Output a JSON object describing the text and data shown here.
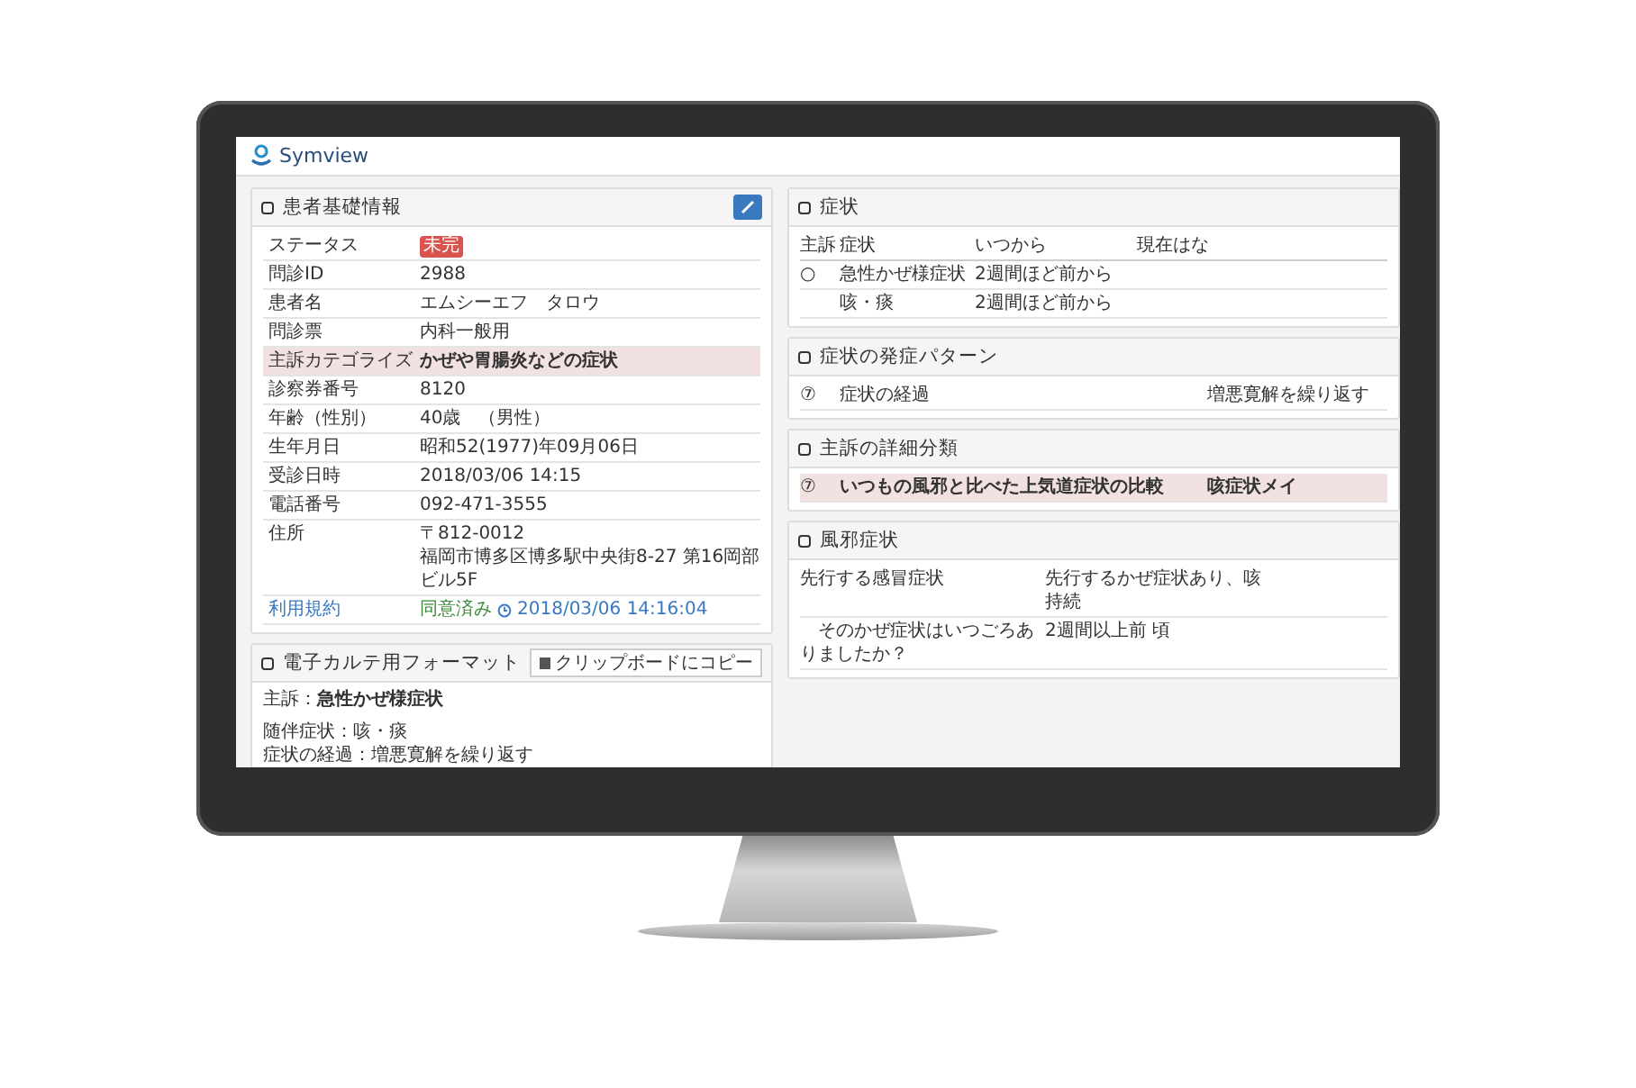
{
  "app": {
    "brand": "Symview"
  },
  "patient": {
    "title": "患者基礎情報",
    "rows": [
      {
        "kind": "badge",
        "label": "ステータス",
        "value": "未完",
        "highlighted": false
      },
      {
        "kind": "text",
        "label": "問診ID",
        "value": "2988",
        "highlighted": false
      },
      {
        "kind": "text",
        "label": "患者名",
        "value": "エムシーエフ　タロウ",
        "highlighted": false
      },
      {
        "kind": "text",
        "label": "問診票",
        "value": "内科一般用",
        "highlighted": false
      },
      {
        "kind": "text",
        "label": "主訴カテゴライズ",
        "value": "かぜや胃腸炎などの症状",
        "highlighted": true
      },
      {
        "kind": "text",
        "label": "診察券番号",
        "value": "8120",
        "highlighted": false
      },
      {
        "kind": "text",
        "label": "年齢（性別）",
        "value": "40歳　（男性）",
        "highlighted": false
      },
      {
        "kind": "text",
        "label": "生年月日",
        "value": "昭和52(1977)年09月06日",
        "highlighted": false
      },
      {
        "kind": "text",
        "label": "受診日時",
        "value": "2018/03/06 14:15",
        "highlighted": false
      },
      {
        "kind": "text",
        "label": "電話番号",
        "value": "092-471-3555",
        "highlighted": false
      },
      {
        "kind": "address",
        "label": "住所",
        "value": "〒812-0012",
        "value2": "福岡市博多区博多駅中央街8-27 第16岡部ビル5F",
        "highlighted": false
      },
      {
        "kind": "consent",
        "label": "利用規約",
        "value": "同意済み",
        "value2": "2018/03/06 14:16:04",
        "highlighted": false
      }
    ]
  },
  "karte": {
    "title": "電子カルテ用フォーマット",
    "copy_button": "クリップボードにコピー",
    "lines": [
      {
        "label": "主訴：",
        "value": "急性かぜ様症状",
        "bold": true
      },
      {
        "label": "随伴症状：",
        "value": "咳・痰",
        "bold": false
      },
      {
        "label": "症状の経過：",
        "value": "増悪寛解を繰り返す",
        "bold": false
      }
    ]
  },
  "symptoms": {
    "title": "症状",
    "columns": [
      "主訴",
      "症状",
      "いつから",
      "現在はな"
    ],
    "rows": [
      [
        "○",
        "急性かぜ様症状",
        "2週間ほど前から"
      ],
      [
        "",
        "咳・痰",
        "2週間ほど前から"
      ]
    ]
  },
  "pattern": {
    "title": "症状の発症パターン",
    "rows": [
      {
        "mark": "⑦",
        "label": "症状の経過",
        "value": "増悪寛解を繰り返す",
        "highlighted": false
      }
    ]
  },
  "detail": {
    "title": "主訴の詳細分類",
    "rows": [
      {
        "mark": "⑦",
        "label": "いつもの風邪と比べた上気道症状の比較",
        "value": "咳症状メイ",
        "highlighted": true
      }
    ]
  },
  "cold": {
    "title": "風邪症状",
    "rows": [
      {
        "label": "先行する感冒症状",
        "value": "先行するかぜ症状あり、咳",
        "value2": "持続"
      },
      {
        "label": "　そのかぜ症状はいつごろありましたか？",
        "value": "2週間以上前 頃",
        "value2": ""
      }
    ]
  }
}
